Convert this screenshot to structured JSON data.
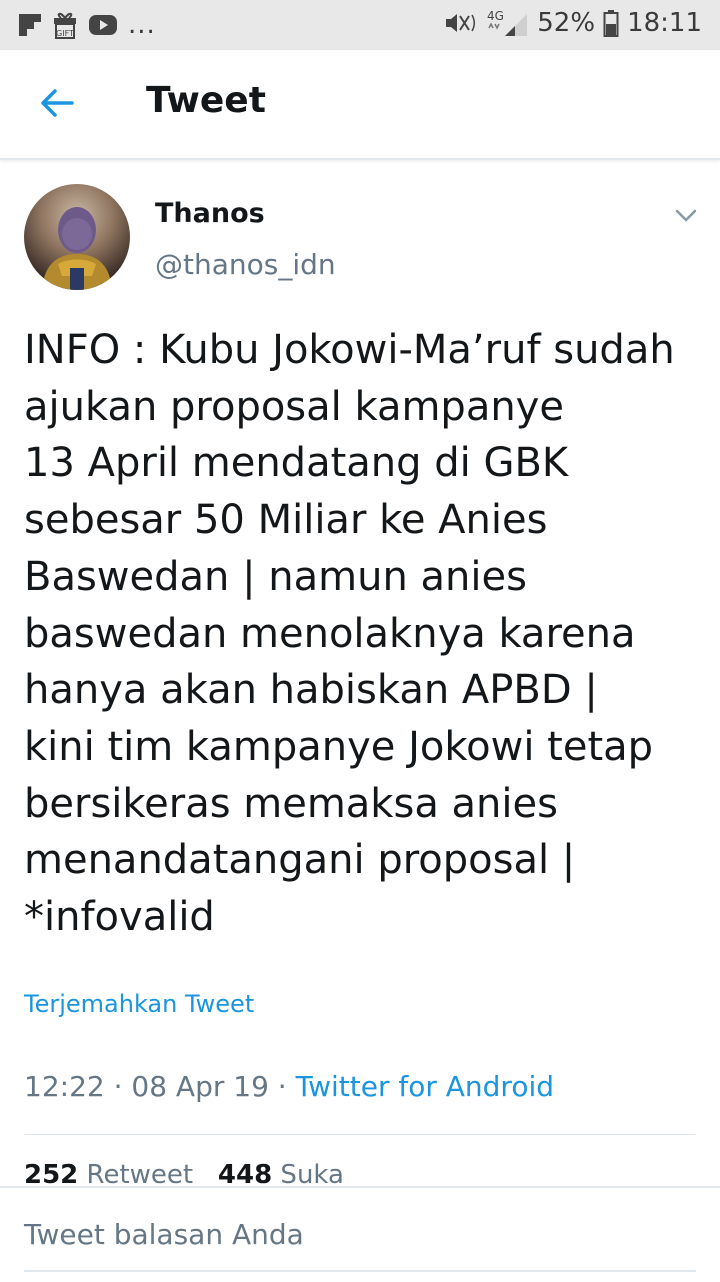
{
  "status_bar": {
    "left_icons": [
      "flipboard-icon",
      "gift-icon",
      "youtube-icon"
    ],
    "dots": "...",
    "battery": "52%",
    "time": "18:11",
    "network": "4G"
  },
  "header": {
    "title": "Tweet",
    "accent": "#1b95e0"
  },
  "tweet": {
    "name": "Thanos",
    "handle": "@thanos_idn",
    "lines": [
      "INFO : Kubu Jokowi-Ma’ruf sudah",
      "ajukan proposal kampanye",
      "13 April mendatang di GBK",
      "sebesar 50 Miliar ke Anies",
      "Baswedan | namun anies",
      "baswedan menolaknya karena",
      "hanya akan habiskan APBD |",
      "kini tim kampanye Jokowi tetap",
      "bersikeras memaksa anies",
      "menandatangani proposal |",
      "*infovalid"
    ],
    "translate": "Terjemahkan Tweet",
    "time": "12:22",
    "sep": " · ",
    "date": "08 Apr 19",
    "source": "Twitter for Android",
    "retweets": "252",
    "retweet_label": " Retweet",
    "likes": "448",
    "like_label": " Suka"
  },
  "reply": {
    "placeholder": "Tweet balasan Anda"
  }
}
